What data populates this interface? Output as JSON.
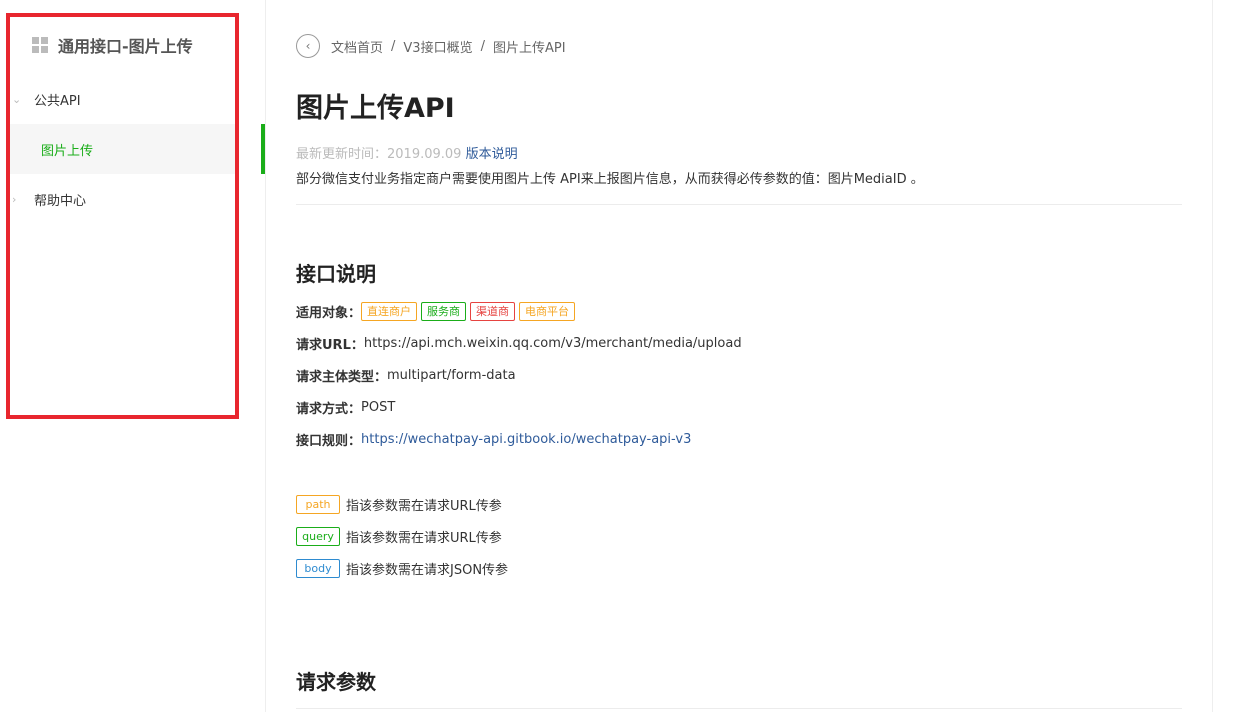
{
  "sidebar": {
    "title": "通用接口-图片上传",
    "sections": [
      {
        "label": "公共API",
        "expanded": true,
        "chevron": "chevron-down-icon"
      },
      {
        "label": "帮助中心",
        "expanded": false,
        "chevron": "chevron-right-icon"
      }
    ],
    "active_item": "图片上传"
  },
  "breadcrumb": [
    "文档首页",
    "V3接口概览",
    "图片上传API"
  ],
  "page": {
    "title": "图片上传API",
    "update_label": "最新更新时间：2019.09.09",
    "version_link": "版本说明",
    "description": "部分微信支付业务指定商户需要使用图片上传 API来上报图片信息，从而获得必传参数的值：图片MediaID 。"
  },
  "interface": {
    "heading": "接口说明",
    "applicable_label": "适用对象：",
    "tags": [
      {
        "label": "直连商户",
        "color": "#f5a623"
      },
      {
        "label": "服务商",
        "color": "#1aad19"
      },
      {
        "label": "渠道商",
        "color": "#e64340"
      },
      {
        "label": "电商平台",
        "color": "#f5a623"
      }
    ],
    "url_label": "请求URL：",
    "url_value": "https://api.mch.weixin.qq.com/v3/merchant/media/upload",
    "content_type_label": "请求主体类型：",
    "content_type_value": "multipart/form-data",
    "method_label": "请求方式：",
    "method_value": "POST",
    "rules_label": "接口规则：",
    "rules_link": "https://wechatpay-api.gitbook.io/wechatpay-api-v3"
  },
  "param_legend": [
    {
      "tag": "path",
      "text": "指该参数需在请求URL传参",
      "color": "#f5a623"
    },
    {
      "tag": "query",
      "text": "指该参数需在请求URL传参",
      "color": "#1aad19"
    },
    {
      "tag": "body",
      "text": "指该参数需在请求JSON传参",
      "color": "#2e8bd0"
    }
  ],
  "request_params": {
    "heading": "请求参数"
  },
  "colors": {
    "accent": "#1aad19",
    "highlight_box": "#e8262e",
    "link": "#2f5b9a"
  }
}
